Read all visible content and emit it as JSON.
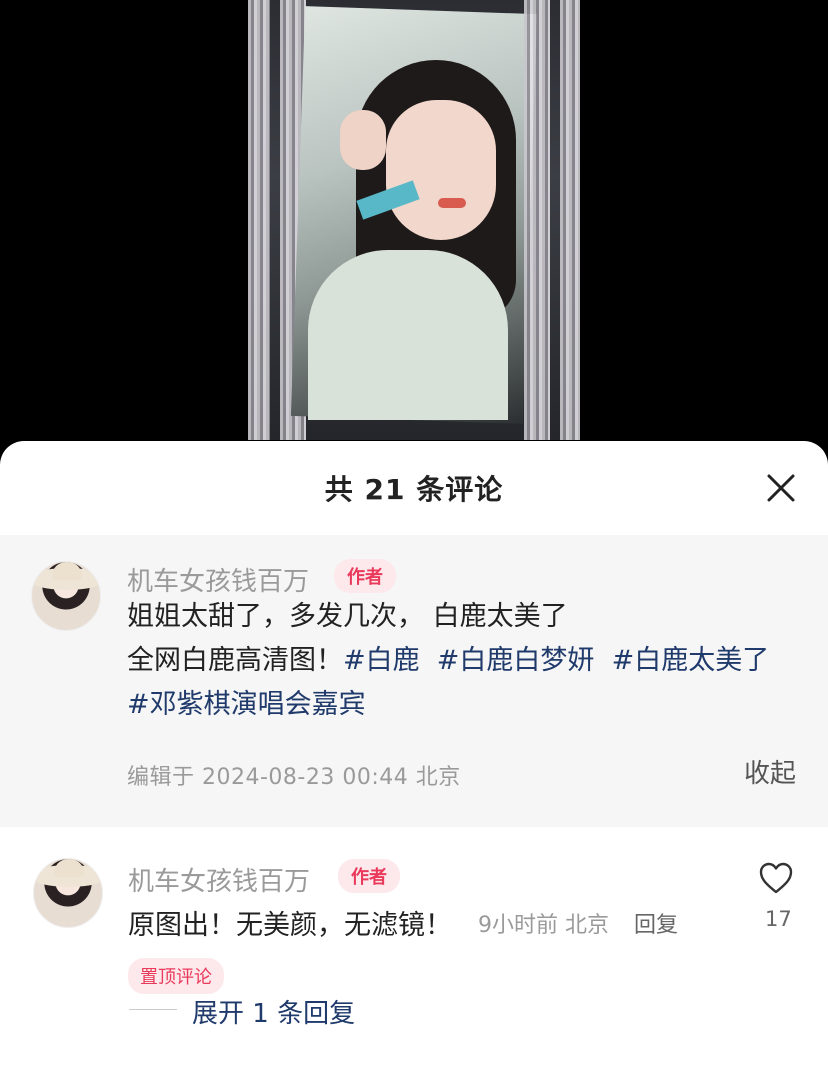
{
  "sheet": {
    "title": "共 21 条评论",
    "close_icon": "close-icon"
  },
  "pinned_comment": {
    "username": "机车女孩钱百万",
    "badge": "作者",
    "line1": "姐姐太甜了，多发几次， 白鹿太美了",
    "line2_prefix": "全网白鹿高清图！",
    "tags": [
      "#白鹿",
      "#白鹿白梦妍",
      "#白鹿太美了",
      "#邓紫棋演唱会嘉宾"
    ],
    "meta": "编辑于 2024-08-23 00:44 北京",
    "collapse_label": "收起"
  },
  "comment": {
    "username": "机车女孩钱百万",
    "badge": "作者",
    "text": "原图出！无美颜，无滤镜！",
    "time_location": "9小时前 北京",
    "reply_label": "回复",
    "like_icon": "heart-icon",
    "like_count": "17",
    "pin_badge": "置顶评论",
    "expand_label": "展开 1 条回复"
  },
  "colors": {
    "accent_red": "#ea3a5b",
    "tag_blue": "#1f3a6b",
    "muted": "#9a9a9a"
  }
}
